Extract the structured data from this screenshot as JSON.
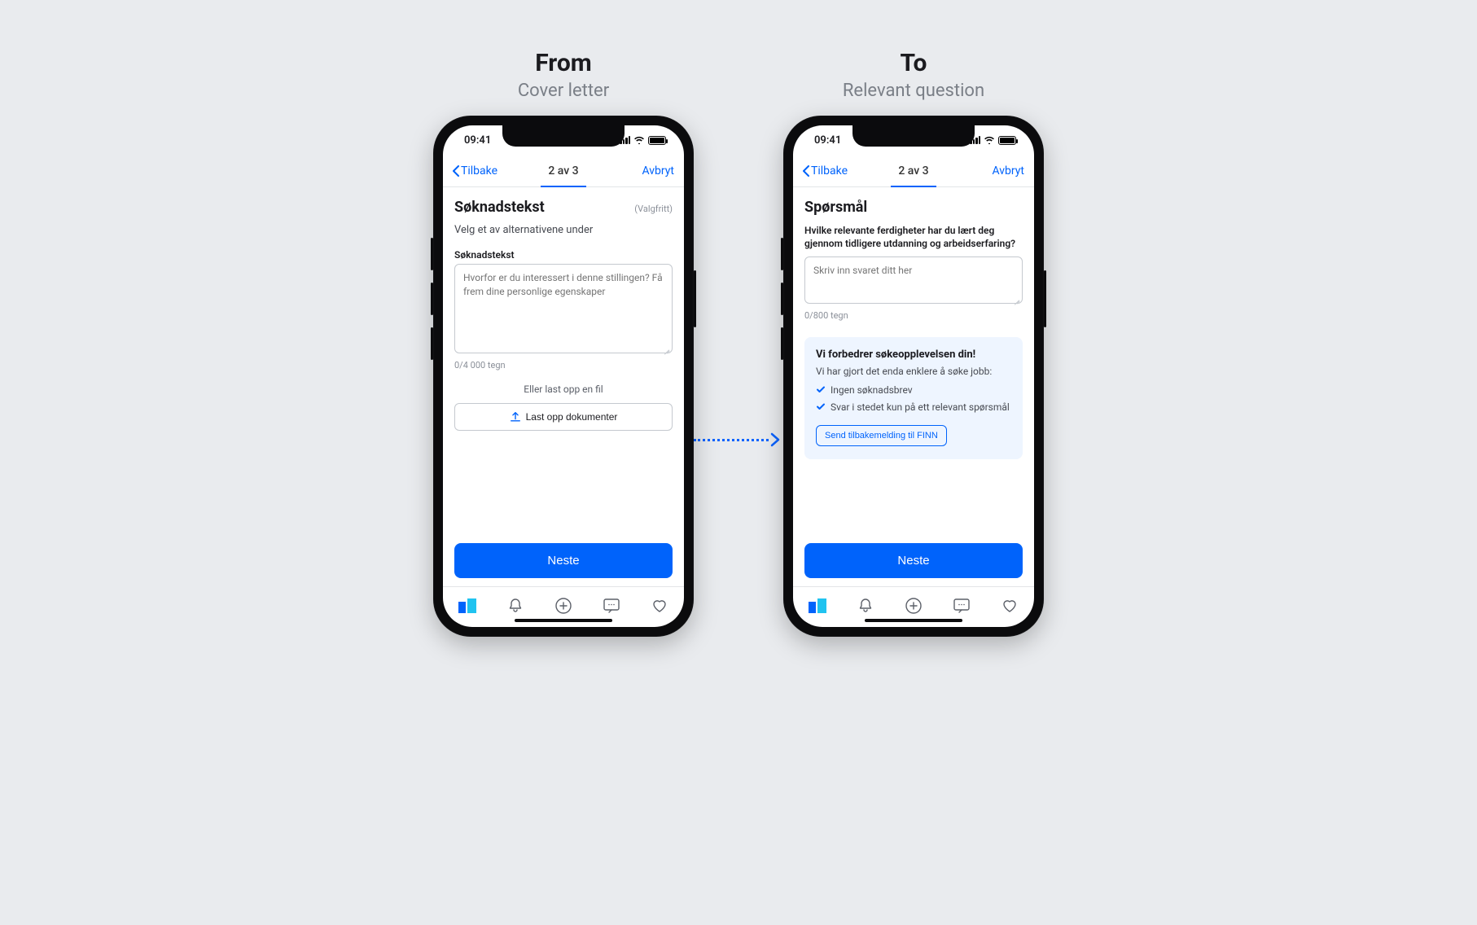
{
  "labels": {
    "from_heading": "From",
    "from_sub": "Cover letter",
    "to_heading": "To",
    "to_sub": "Relevant question"
  },
  "status": {
    "time": "09:41"
  },
  "nav": {
    "back": "Tilbake",
    "step": "2 av 3",
    "cancel": "Avbryt"
  },
  "from": {
    "title": "Søknadstekst",
    "optional": "(Valgfritt)",
    "instruction": "Velg et av alternativene under",
    "field_label": "Søknadstekst",
    "placeholder": "Hvorfor er du interessert i denne stillingen? Få frem dine personlige egenskaper",
    "char_count": "0/4 000 tegn",
    "or_text": "Eller last opp en fil",
    "upload_label": "Last opp dokumenter"
  },
  "to": {
    "title": "Spørsmål",
    "question": "Hvilke relevante ferdigheter har du lært deg gjennom tidligere utdanning og arbeidserfaring?",
    "placeholder": "Skriv inn svaret ditt her",
    "char_count": "0/800 tegn",
    "info_title": "Vi forbedrer søkeopplevelsen din!",
    "info_lead": "Vi har gjort det enda enklere å søke jobb:",
    "info_items": [
      "Ingen søknadsbrev",
      "Svar i stedet kun på ett relevant spørsmål"
    ],
    "feedback_btn": "Send tilbakemelding til FINN"
  },
  "primary_btn": "Neste",
  "colors": {
    "primary": "#0063fb",
    "bg": "#e9ebee",
    "info_bg": "#eef5ff"
  }
}
